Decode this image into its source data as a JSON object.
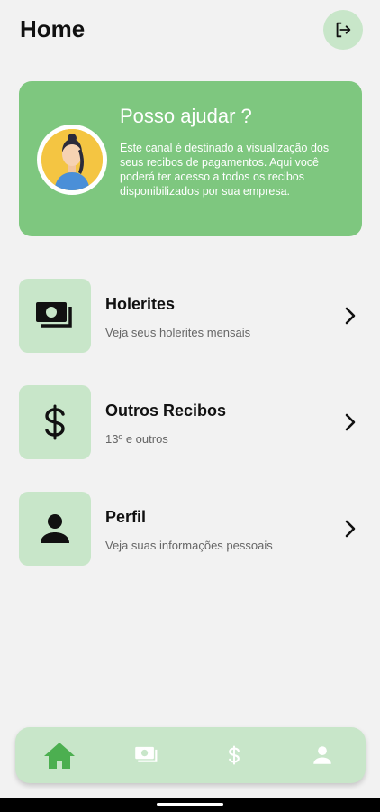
{
  "header": {
    "title": "Home",
    "logout_icon": "logout-icon"
  },
  "help_card": {
    "title": "Posso ajudar ?",
    "text": "Este canal é destinado a visualização dos seus recibos de pagamentos. Aqui você poderá ter acesso a todos os recibos disponibilizados por sua empresa.",
    "avatar_icon": "avatar-woman"
  },
  "menu": [
    {
      "title": "Holerites",
      "subtitle": "Veja seus holerites mensais",
      "icon": "money-stack-icon"
    },
    {
      "title": "Outros Recibos",
      "subtitle": "13º e outros",
      "icon": "dollar-icon"
    },
    {
      "title": "Perfil",
      "subtitle": "Veja suas informações pessoais",
      "icon": "person-icon"
    }
  ],
  "bottom_nav": [
    {
      "icon": "home-icon",
      "active": true
    },
    {
      "icon": "money-stack-icon",
      "active": false
    },
    {
      "icon": "dollar-icon",
      "active": false
    },
    {
      "icon": "person-icon",
      "active": false
    }
  ],
  "colors": {
    "accent": "#7ec77f",
    "accent_light": "#c8e6c9",
    "active_nav": "#4caf50",
    "background": "#f2f2f2"
  }
}
